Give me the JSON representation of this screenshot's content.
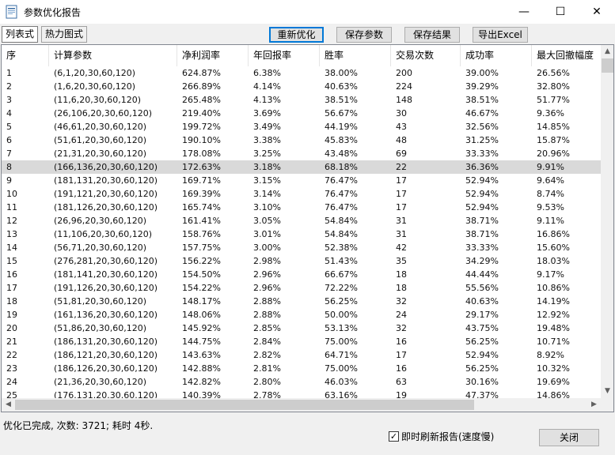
{
  "window": {
    "title": "参数优化报告",
    "icon": "report-icon",
    "controls": {
      "minimize": "—",
      "maximize": "☐",
      "close": "✕"
    }
  },
  "tabs": [
    "列表式",
    "热力图式"
  ],
  "toolbar": {
    "reoptimize": "重新优化",
    "save_params": "保存参数",
    "save_results": "保存结果",
    "export_excel": "导出Excel"
  },
  "table": {
    "columns": [
      "序",
      "计算参数",
      "净利润率",
      "年回报率",
      "胜率",
      "交易次数",
      "成功率",
      "最大回撤幅度"
    ],
    "selected_row": 8,
    "rows": [
      [
        "1",
        "(6,1,20,30,60,120)",
        "624.87%",
        "6.38%",
        "38.00%",
        "200",
        "39.00%",
        "26.56%"
      ],
      [
        "2",
        "(1,6,20,30,60,120)",
        "266.89%",
        "4.14%",
        "40.63%",
        "224",
        "39.29%",
        "32.80%"
      ],
      [
        "3",
        "(11,6,20,30,60,120)",
        "265.48%",
        "4.13%",
        "38.51%",
        "148",
        "38.51%",
        "51.77%"
      ],
      [
        "4",
        "(26,106,20,30,60,120)",
        "219.40%",
        "3.69%",
        "56.67%",
        "30",
        "46.67%",
        "9.36%"
      ],
      [
        "5",
        "(46,61,20,30,60,120)",
        "199.72%",
        "3.49%",
        "44.19%",
        "43",
        "32.56%",
        "14.85%"
      ],
      [
        "6",
        "(51,61,20,30,60,120)",
        "190.10%",
        "3.38%",
        "45.83%",
        "48",
        "31.25%",
        "15.87%"
      ],
      [
        "7",
        "(21,31,20,30,60,120)",
        "178.08%",
        "3.25%",
        "43.48%",
        "69",
        "33.33%",
        "20.96%"
      ],
      [
        "8",
        "(166,136,20,30,60,120)",
        "172.63%",
        "3.18%",
        "68.18%",
        "22",
        "36.36%",
        "9.91%"
      ],
      [
        "9",
        "(181,131,20,30,60,120)",
        "169.71%",
        "3.15%",
        "76.47%",
        "17",
        "52.94%",
        "9.64%"
      ],
      [
        "10",
        "(191,121,20,30,60,120)",
        "169.39%",
        "3.14%",
        "76.47%",
        "17",
        "52.94%",
        "8.74%"
      ],
      [
        "11",
        "(181,126,20,30,60,120)",
        "165.74%",
        "3.10%",
        "76.47%",
        "17",
        "52.94%",
        "9.53%"
      ],
      [
        "12",
        "(26,96,20,30,60,120)",
        "161.41%",
        "3.05%",
        "54.84%",
        "31",
        "38.71%",
        "9.11%"
      ],
      [
        "13",
        "(11,106,20,30,60,120)",
        "158.76%",
        "3.01%",
        "54.84%",
        "31",
        "38.71%",
        "16.86%"
      ],
      [
        "14",
        "(56,71,20,30,60,120)",
        "157.75%",
        "3.00%",
        "52.38%",
        "42",
        "33.33%",
        "15.60%"
      ],
      [
        "15",
        "(276,281,20,30,60,120)",
        "156.22%",
        "2.98%",
        "51.43%",
        "35",
        "34.29%",
        "18.03%"
      ],
      [
        "16",
        "(181,141,20,30,60,120)",
        "154.50%",
        "2.96%",
        "66.67%",
        "18",
        "44.44%",
        "9.17%"
      ],
      [
        "17",
        "(191,126,20,30,60,120)",
        "154.22%",
        "2.96%",
        "72.22%",
        "18",
        "55.56%",
        "10.86%"
      ],
      [
        "18",
        "(51,81,20,30,60,120)",
        "148.17%",
        "2.88%",
        "56.25%",
        "32",
        "40.63%",
        "14.19%"
      ],
      [
        "19",
        "(161,136,20,30,60,120)",
        "148.06%",
        "2.88%",
        "50.00%",
        "24",
        "29.17%",
        "12.92%"
      ],
      [
        "20",
        "(51,86,20,30,60,120)",
        "145.92%",
        "2.85%",
        "53.13%",
        "32",
        "43.75%",
        "19.48%"
      ],
      [
        "21",
        "(186,131,20,30,60,120)",
        "144.75%",
        "2.84%",
        "75.00%",
        "16",
        "56.25%",
        "10.71%"
      ],
      [
        "22",
        "(186,121,20,30,60,120)",
        "143.63%",
        "2.82%",
        "64.71%",
        "17",
        "52.94%",
        "8.92%"
      ],
      [
        "23",
        "(186,126,20,30,60,120)",
        "142.88%",
        "2.81%",
        "75.00%",
        "16",
        "56.25%",
        "10.32%"
      ],
      [
        "24",
        "(21,36,20,30,60,120)",
        "142.82%",
        "2.80%",
        "46.03%",
        "63",
        "30.16%",
        "19.69%"
      ],
      [
        "25",
        "(176.131.20.30.60.120)",
        "140.39%",
        "2.78%",
        "63.16%",
        "19",
        "47.37%",
        "14.86%"
      ]
    ]
  },
  "status": "优化已完成, 次数: 3721; 耗时 4秒.",
  "refresh_checkbox": {
    "label": "即时刷新报告(速度慢)",
    "checked": true
  },
  "close_label": "关闭",
  "colors": {
    "selected_row": "#d9d9d9",
    "default_button_border": "#0078d7"
  }
}
